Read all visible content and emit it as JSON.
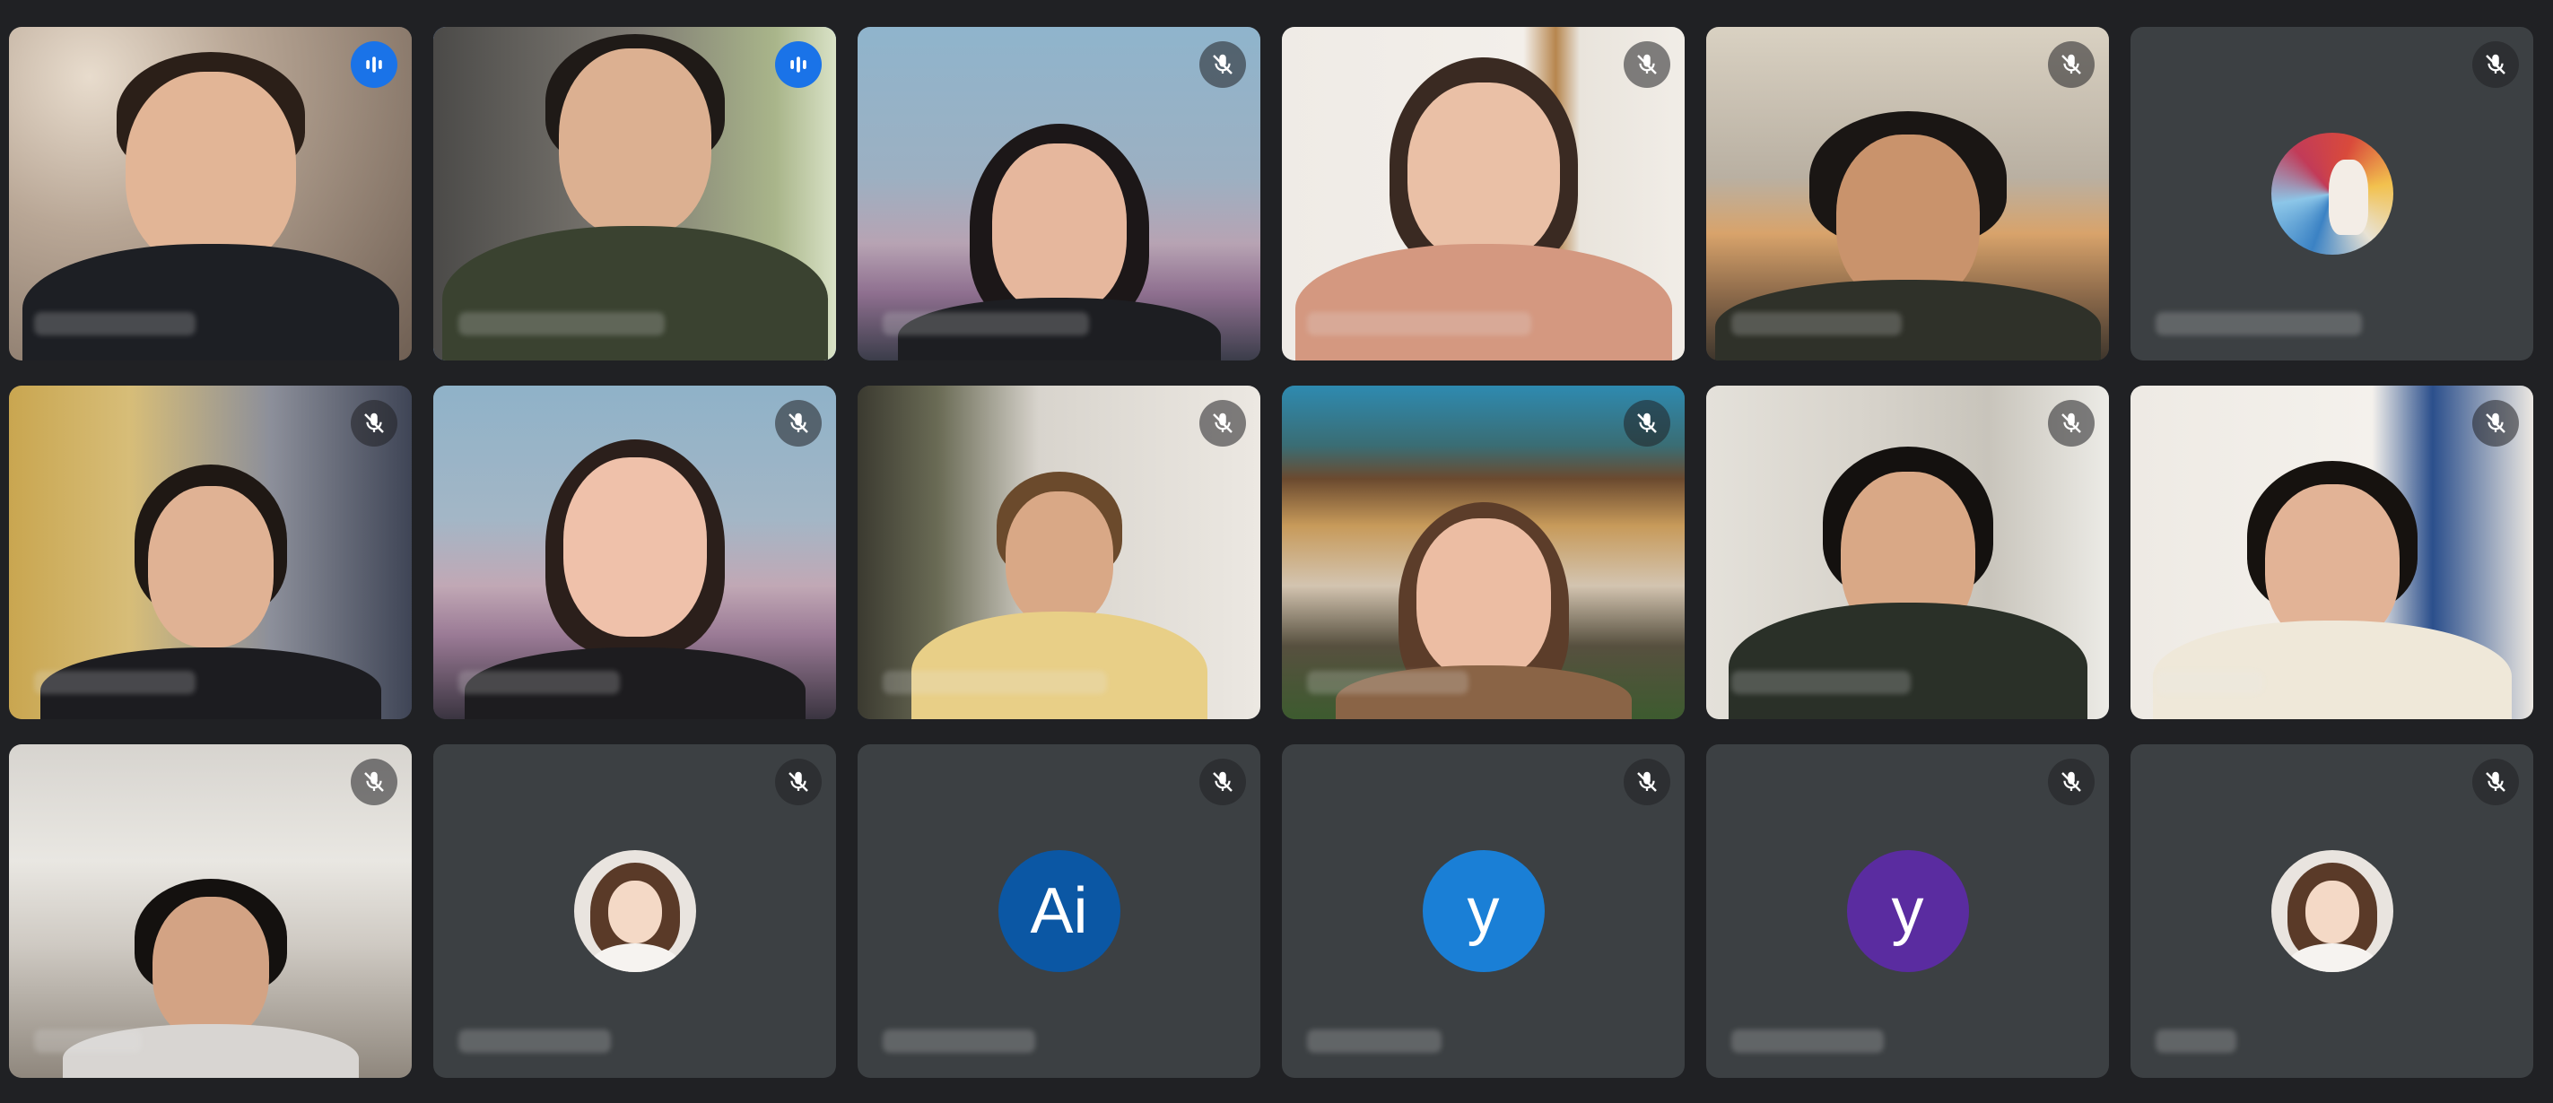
{
  "app": "video-conference-grid",
  "colors": {
    "page_bg": "#202124",
    "tile_bg": "#3c4043",
    "speaking_outline": "#669df6",
    "active_badge": "#1a73e8"
  },
  "participants": [
    {
      "id": "p1",
      "type": "video",
      "mic": "speaking",
      "speaking_outline": false,
      "name": ""
    },
    {
      "id": "p2",
      "type": "video",
      "mic": "speaking",
      "speaking_outline": true,
      "name": ""
    },
    {
      "id": "p3",
      "type": "video",
      "mic": "muted",
      "speaking_outline": false,
      "name": ""
    },
    {
      "id": "p4",
      "type": "video",
      "mic": "muted",
      "speaking_outline": false,
      "name": ""
    },
    {
      "id": "p5",
      "type": "video",
      "mic": "muted",
      "speaking_outline": false,
      "name": ""
    },
    {
      "id": "p6",
      "type": "avatar-art",
      "mic": "muted",
      "speaking_outline": false,
      "name": ""
    },
    {
      "id": "p7",
      "type": "video",
      "mic": "muted",
      "speaking_outline": false,
      "name": ""
    },
    {
      "id": "p8",
      "type": "video",
      "mic": "muted",
      "speaking_outline": false,
      "name": ""
    },
    {
      "id": "p9",
      "type": "video",
      "mic": "muted",
      "speaking_outline": false,
      "name": ""
    },
    {
      "id": "p10",
      "type": "video",
      "mic": "muted",
      "speaking_outline": false,
      "name": ""
    },
    {
      "id": "p11",
      "type": "video",
      "mic": "muted",
      "speaking_outline": false,
      "name": ""
    },
    {
      "id": "p12",
      "type": "video",
      "mic": "muted",
      "speaking_outline": false,
      "name": ""
    },
    {
      "id": "p13",
      "type": "video",
      "mic": "muted",
      "speaking_outline": false,
      "name": ""
    },
    {
      "id": "p14",
      "type": "avatar-photo",
      "mic": "muted",
      "speaking_outline": false,
      "name": ""
    },
    {
      "id": "p15",
      "type": "avatar-letter",
      "avatar_letter": "Ai",
      "avatar_color": "#0b57a4",
      "mic": "muted",
      "speaking_outline": false,
      "name": ""
    },
    {
      "id": "p16",
      "type": "avatar-letter",
      "avatar_letter": "y",
      "avatar_color": "#1a7fd6",
      "mic": "muted",
      "speaking_outline": false,
      "name": ""
    },
    {
      "id": "p17",
      "type": "avatar-letter",
      "avatar_letter": "y",
      "avatar_color": "#5a2ca0",
      "mic": "muted",
      "speaking_outline": false,
      "name": ""
    },
    {
      "id": "p18",
      "type": "avatar-photo",
      "mic": "muted",
      "speaking_outline": false,
      "name": ""
    }
  ],
  "icons": {
    "speaking": "audio-level-icon",
    "muted": "mic-off-icon"
  }
}
